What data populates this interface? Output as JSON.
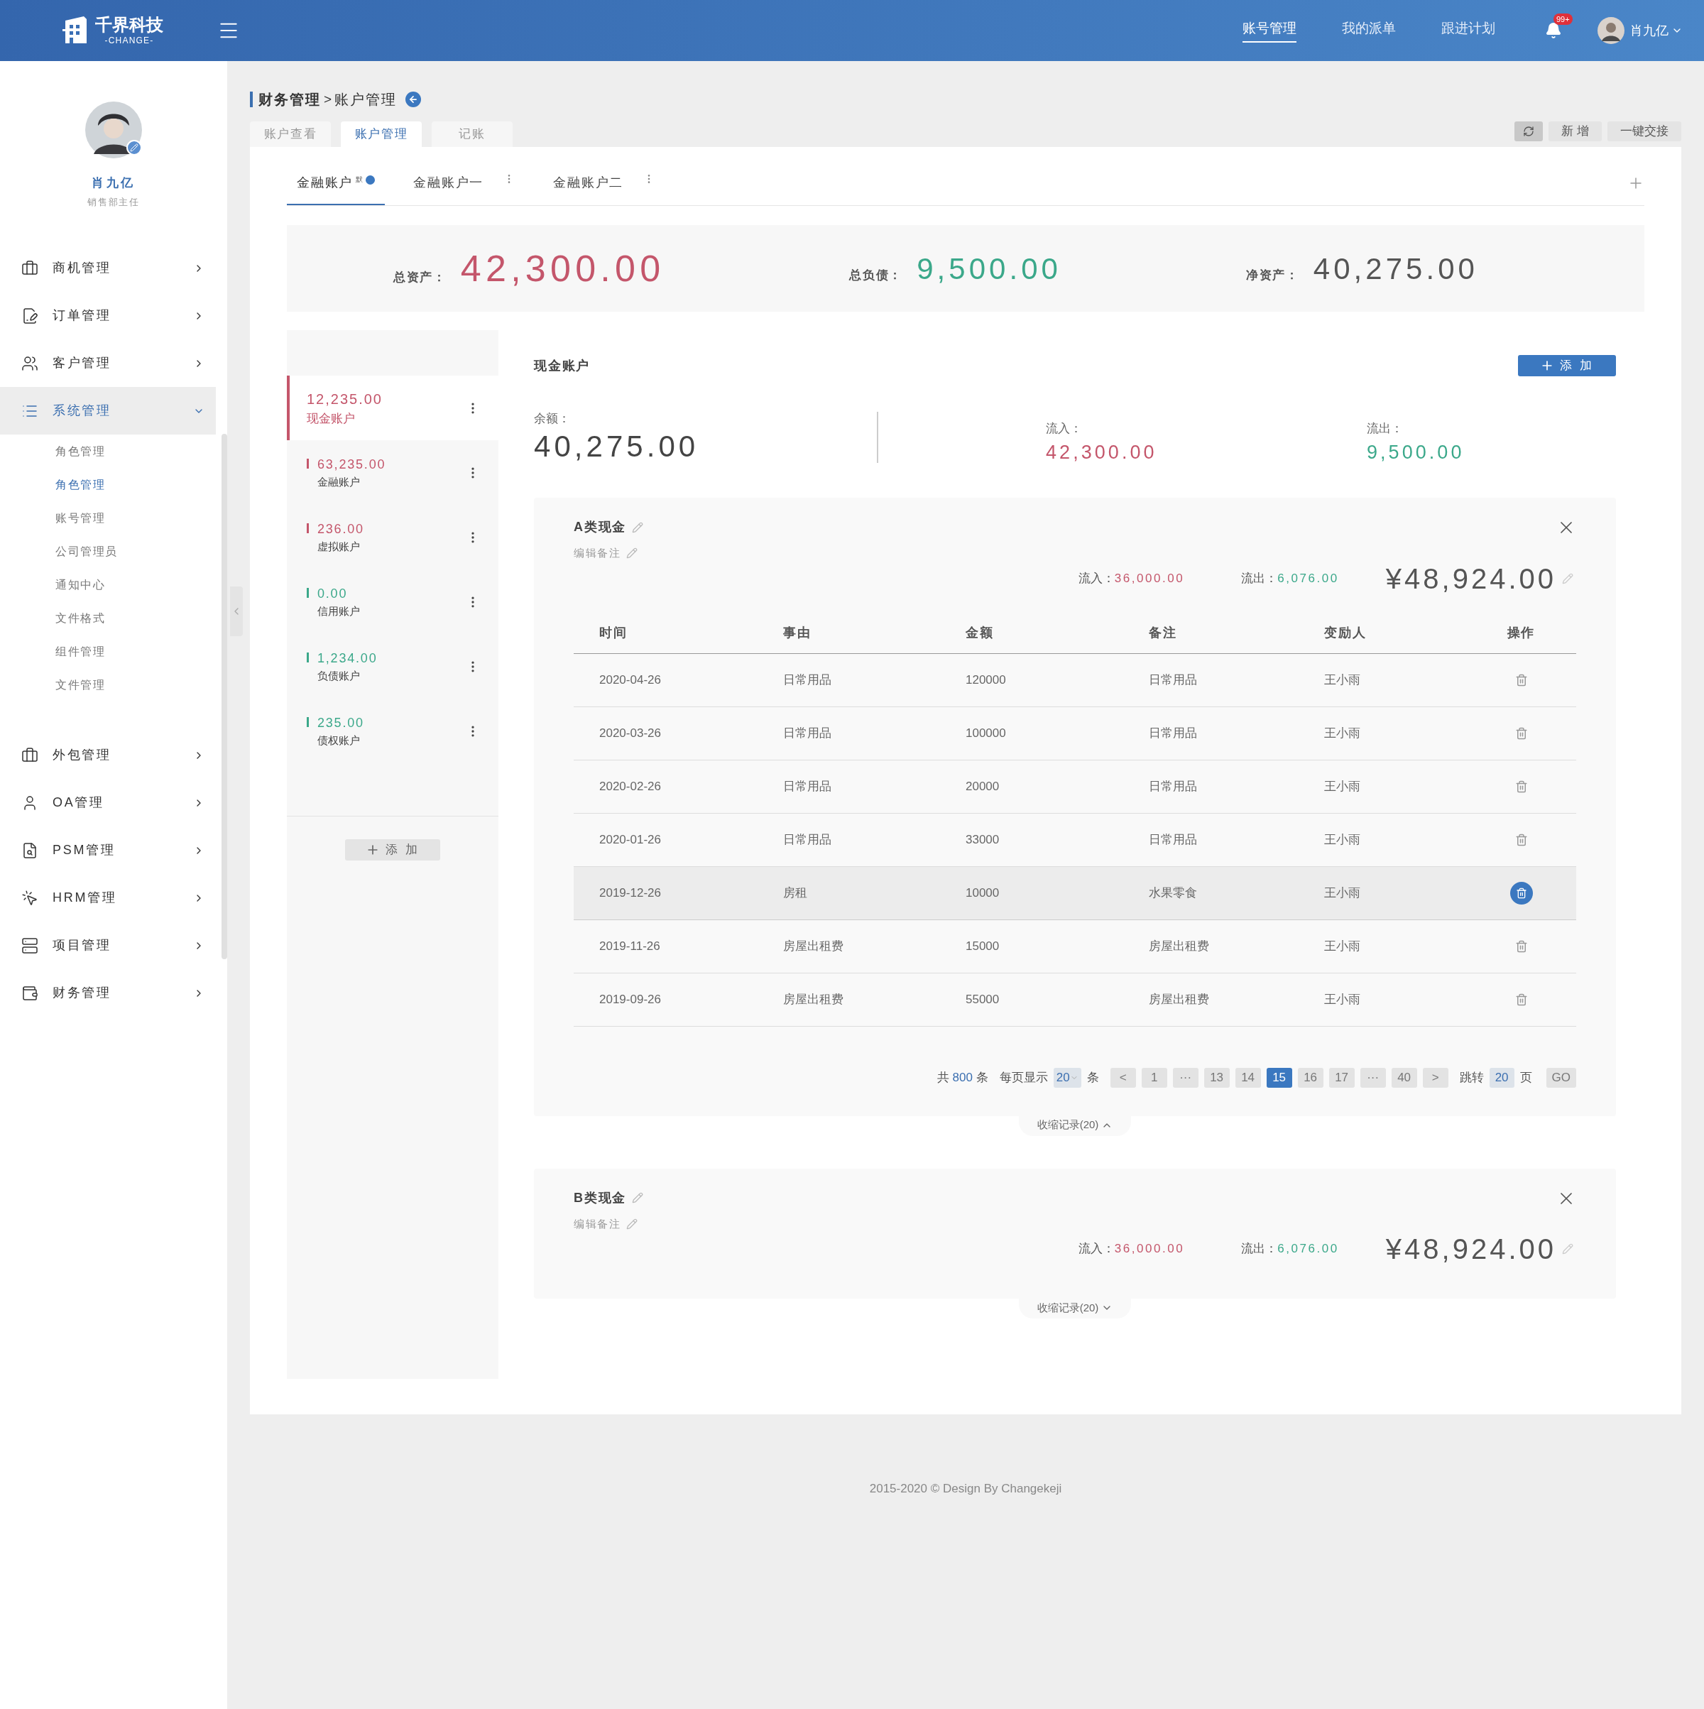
{
  "header": {
    "logo": {
      "name": "千界科技",
      "sub": "-CHANGE-"
    },
    "nav": [
      {
        "label": "账号管理",
        "selected": true
      },
      {
        "label": "我的派单",
        "selected": false
      },
      {
        "label": "跟进计划",
        "selected": false
      }
    ],
    "badge": "99+",
    "user": "肖九亿"
  },
  "profile": {
    "name": "肖九亿",
    "title": "销售部主任"
  },
  "sidebar": {
    "items": [
      {
        "label": "商机管理",
        "selected": false,
        "expanded": false
      },
      {
        "label": "订单管理",
        "selected": false,
        "expanded": false
      },
      {
        "label": "客户管理",
        "selected": false,
        "expanded": false
      },
      {
        "label": "系统管理",
        "selected": true,
        "expanded": true,
        "children": [
          {
            "label": "角色管理",
            "selected": false
          },
          {
            "label": "角色管理",
            "selected": true
          },
          {
            "label": "账号管理",
            "selected": false
          },
          {
            "label": "公司管理员",
            "selected": false
          },
          {
            "label": "通知中心",
            "selected": false
          },
          {
            "label": "文件格式",
            "selected": false
          },
          {
            "label": "组件管理",
            "selected": false
          },
          {
            "label": "文件管理",
            "selected": false
          }
        ]
      },
      {
        "label": "外包管理",
        "selected": false,
        "expanded": false
      },
      {
        "label": "OA管理",
        "selected": false,
        "expanded": false
      },
      {
        "label": "PSM管理",
        "selected": false,
        "expanded": false
      },
      {
        "label": "HRM管理",
        "selected": false,
        "expanded": false
      },
      {
        "label": "项目管理",
        "selected": false,
        "expanded": false
      },
      {
        "label": "财务管理",
        "selected": false,
        "expanded": false
      }
    ]
  },
  "breadcrumb": [
    "财务管理",
    "账户管理"
  ],
  "breadcrumb_separator": ">",
  "page_tabs": [
    {
      "label": "账户查看",
      "selected": false
    },
    {
      "label": "账户管理",
      "selected": true
    },
    {
      "label": "记账",
      "selected": false
    }
  ],
  "actions": [
    "新 增",
    "一键交接"
  ],
  "account_tabs": [
    {
      "label": "金融账户",
      "tag": "默",
      "selected": true
    },
    {
      "label": "金融账户一",
      "selected": false
    },
    {
      "label": "金融账户二",
      "selected": false
    }
  ],
  "summary": [
    {
      "label": "总资产：",
      "value": "42,300.00",
      "kind": "asset"
    },
    {
      "label": "总负债：",
      "value": "9,500.00",
      "kind": "liability"
    },
    {
      "label": "净资产：",
      "value": "40,275.00",
      "kind": "net"
    }
  ],
  "accounts": [
    {
      "amount": "12,235.00",
      "name": "现金账户",
      "color": "#c4566b",
      "selected": true
    },
    {
      "amount": "63,235.00",
      "name": "金融账户",
      "color": "#c4566b",
      "selected": false
    },
    {
      "amount": "236.00",
      "name": "虚拟账户",
      "color": "#c4566b",
      "selected": false
    },
    {
      "amount": "0.00",
      "name": "信用账户",
      "color": "#3ba88a",
      "selected": false
    },
    {
      "amount": "1,234.00",
      "name": "负债账户",
      "color": "#3ba88a",
      "selected": false
    },
    {
      "amount": "235.00",
      "name": "债权账户",
      "color": "#3ba88a",
      "selected": false
    }
  ],
  "accounts_add": "添 加",
  "cash": {
    "title": "现金账户",
    "add": "添 加",
    "balance_label": "余额：",
    "balance": "40,275.00",
    "inflow_label": "流入：",
    "inflow": "42,300.00",
    "outflow_label": "流出：",
    "outflow": "9,500.00"
  },
  "groups": [
    {
      "title": "A类现金",
      "note": "编辑备注",
      "inflow_label": "流入：",
      "inflow": "36,000.00",
      "outflow_label": "流出：",
      "outflow": "6,076.00",
      "total": "¥48,924.00",
      "expanded": true,
      "toggle": "收缩记录(20)",
      "table": {
        "columns": [
          "时间",
          "事由",
          "金额",
          "备注",
          "变励人",
          "操作"
        ],
        "rows": [
          {
            "cells": [
              "2020-04-26",
              "日常用品",
              "120000",
              "日常用品",
              "王小雨"
            ],
            "selected": false
          },
          {
            "cells": [
              "2020-03-26",
              "日常用品",
              "100000",
              "日常用品",
              "王小雨"
            ],
            "selected": false
          },
          {
            "cells": [
              "2020-02-26",
              "日常用品",
              "20000",
              "日常用品",
              "王小雨"
            ],
            "selected": false
          },
          {
            "cells": [
              "2020-01-26",
              "日常用品",
              "33000",
              "日常用品",
              "王小雨"
            ],
            "selected": false
          },
          {
            "cells": [
              "2019-12-26",
              "房租",
              "10000",
              "水果零食",
              "王小雨"
            ],
            "selected": true
          },
          {
            "cells": [
              "2019-11-26",
              "房屋出租费",
              "15000",
              "房屋出租费",
              "王小雨"
            ],
            "selected": false
          },
          {
            "cells": [
              "2019-09-26",
              "房屋出租费",
              "55000",
              "房屋出租费",
              "王小雨"
            ],
            "selected": false
          }
        ]
      },
      "pagination": {
        "total_prefix": "共",
        "total": "800",
        "total_suffix": "条",
        "per_page_label": "每页显示",
        "per_page": "20",
        "per_page_suffix": "条",
        "pages": [
          {
            "label": "<",
            "selected": false
          },
          {
            "label": "1",
            "selected": false
          },
          {
            "label": "···",
            "selected": false
          },
          {
            "label": "13",
            "selected": false
          },
          {
            "label": "14",
            "selected": false
          },
          {
            "label": "15",
            "selected": true
          },
          {
            "label": "16",
            "selected": false
          },
          {
            "label": "17",
            "selected": false
          },
          {
            "label": "···",
            "selected": false
          },
          {
            "label": "40",
            "selected": false
          },
          {
            "label": ">",
            "selected": false
          }
        ],
        "jump_label": "跳转",
        "jump_value": "20",
        "jump_suffix": "页",
        "go": "GO"
      }
    },
    {
      "title": "B类现金",
      "note": "编辑备注",
      "inflow_label": "流入：",
      "inflow": "36,000.00",
      "outflow_label": "流出：",
      "outflow": "6,076.00",
      "total": "¥48,924.00",
      "expanded": false,
      "toggle": "收缩记录(20)"
    }
  ],
  "footer": "2015-2020 © Design By Changekeji"
}
